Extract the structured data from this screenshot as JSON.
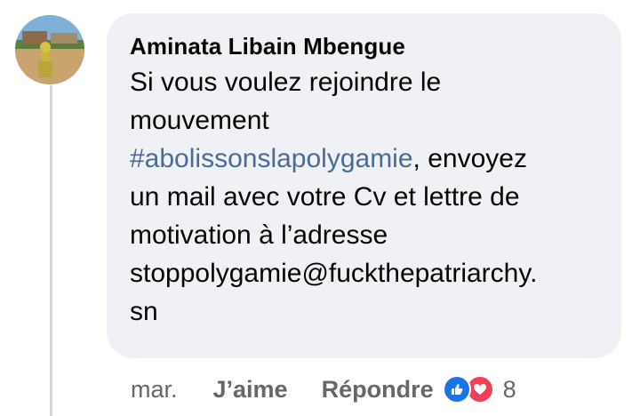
{
  "comment": {
    "author": "Aminata Libain Mbengue",
    "lines": [
      "Si vous voulez rejoindre le",
      "mouvement"
    ],
    "hashtag": "#abolissonslapolygamie",
    "after_hashtag": ", envoyez",
    "lines_after": [
      "un mail avec votre Cv et lettre de",
      "motivation à l’adresse",
      "stoppolygamie@fuckthepatriarchy.",
      "sn"
    ]
  },
  "footer": {
    "time": "mar.",
    "like_label": "J’aime",
    "reply_label": "Répondre",
    "reaction_count": "8",
    "reactions": [
      "like-icon",
      "love-icon"
    ]
  },
  "colors": {
    "bubble": "#eff1f4",
    "hashtag": "#4b6b96",
    "meta": "#65676b",
    "like_reaction": "#1b74e4",
    "love_reaction": "#f33e58"
  }
}
